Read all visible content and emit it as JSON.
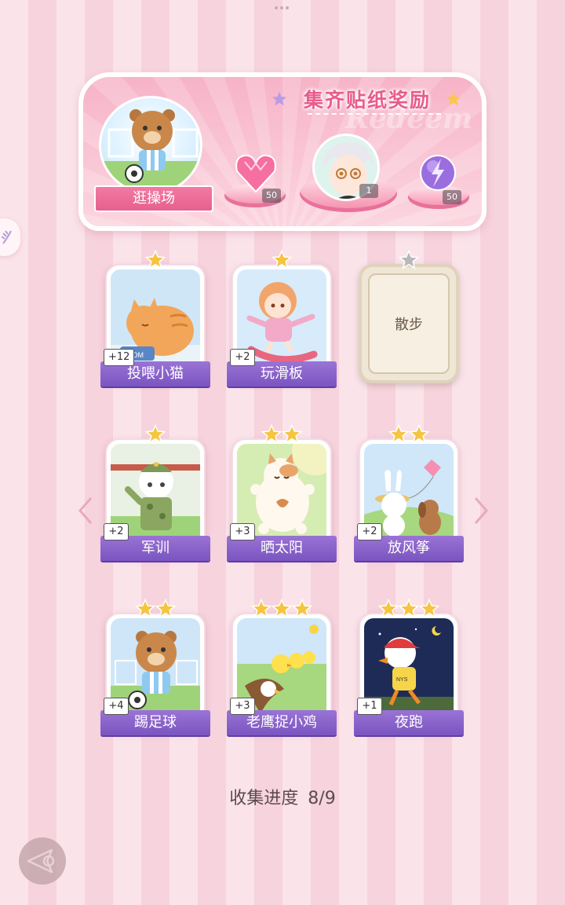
{
  "banner": {
    "title": "集齐贴纸奖励",
    "watermark": "Redeem",
    "main_sticker_label": "逛操场",
    "rewards": [
      {
        "icon": "pink-heart-gem-icon",
        "count": "50"
      },
      {
        "icon": "character-avatar-icon",
        "count": "1"
      },
      {
        "icon": "purple-lightning-orb-icon",
        "count": "50"
      }
    ]
  },
  "cards": [
    {
      "label": "投喂小猫",
      "bonus": "+12",
      "stars": 1,
      "collected": true,
      "art": "orange-cat-eating"
    },
    {
      "label": "玩滑板",
      "bonus": "+2",
      "stars": 1,
      "collected": true,
      "art": "girl-skateboard"
    },
    {
      "label": "散步",
      "bonus": "",
      "stars": 1,
      "collected": false,
      "art": "locked"
    },
    {
      "label": "军训",
      "bonus": "+2",
      "stars": 1,
      "collected": true,
      "art": "soldier-cat"
    },
    {
      "label": "晒太阳",
      "bonus": "+3",
      "stars": 2,
      "collected": true,
      "art": "sunbathing-cat"
    },
    {
      "label": "放风筝",
      "bonus": "+2",
      "stars": 2,
      "collected": true,
      "art": "bunny-kite"
    },
    {
      "label": "踢足球",
      "bonus": "+4",
      "stars": 2,
      "collected": true,
      "art": "bear-soccer"
    },
    {
      "label": "老鹰捉小鸡",
      "bonus": "+3",
      "stars": 3,
      "collected": true,
      "art": "eagle-chicks"
    },
    {
      "label": "夜跑",
      "bonus": "+1",
      "stars": 3,
      "collected": true,
      "art": "duck-night-run"
    }
  ],
  "progress": {
    "label": "收集进度",
    "value": "8/9"
  },
  "colors": {
    "accent_pink": "#e85c8c",
    "ribbon_purple": "#8a64cc",
    "star_gold": "#f5c542",
    "star_gray": "#b8b8b8"
  }
}
